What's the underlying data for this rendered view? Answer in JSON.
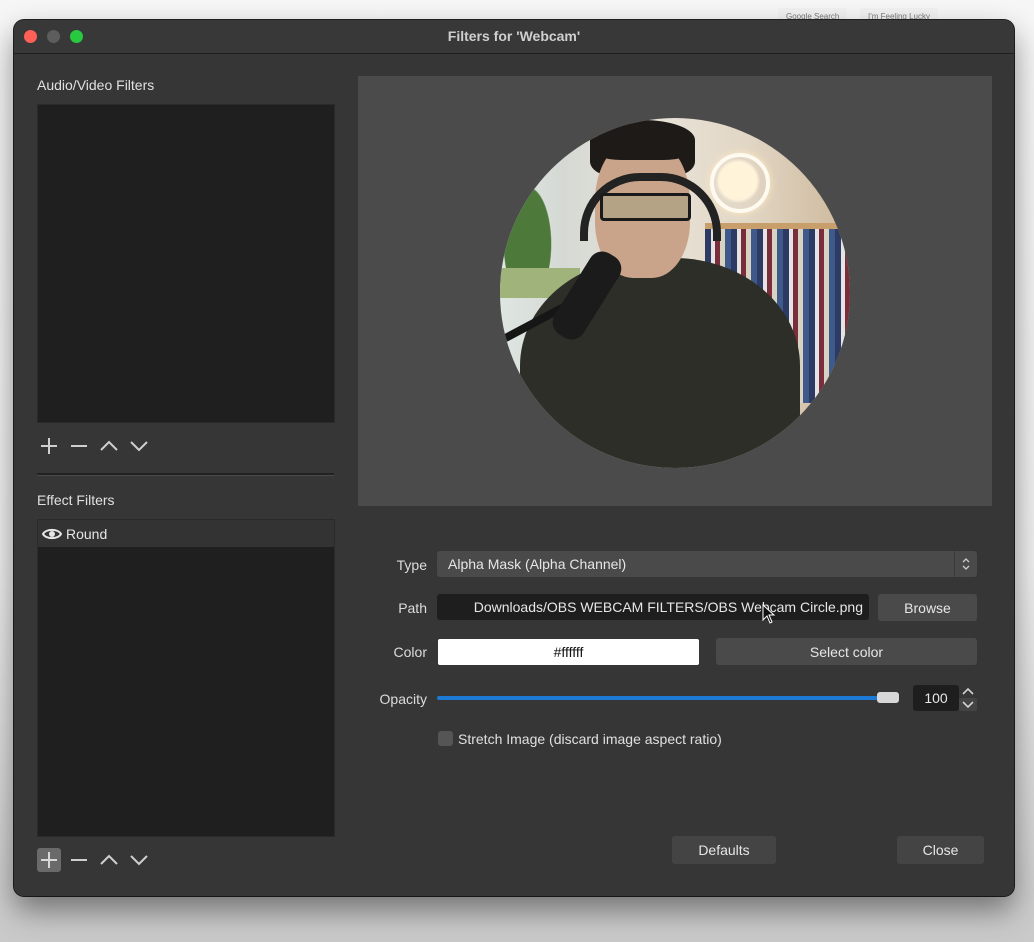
{
  "background": {
    "buttons": [
      "Google Search",
      "I'm Feeling Lucky"
    ]
  },
  "window": {
    "title": "Filters for 'Webcam'"
  },
  "audio_video_filters": {
    "label": "Audio/Video Filters",
    "items": [],
    "toolbar": [
      "add",
      "remove",
      "move-up",
      "move-down"
    ]
  },
  "effect_filters": {
    "label": "Effect Filters",
    "items": [
      {
        "name": "Round",
        "visible": true,
        "selected": true
      }
    ],
    "toolbar": [
      "add",
      "remove",
      "move-up",
      "move-down"
    ]
  },
  "properties": {
    "type": {
      "label": "Type",
      "value": "Alpha Mask (Alpha Channel)"
    },
    "path": {
      "label": "Path",
      "value": "Downloads/OBS WEBCAM FILTERS/OBS Webcam Circle.png",
      "browse_label": "Browse"
    },
    "color": {
      "label": "Color",
      "value": "#ffffff",
      "select_label": "Select color"
    },
    "opacity": {
      "label": "Opacity",
      "value": "100",
      "percent": 100
    },
    "stretch": {
      "label": "Stretch Image (discard image aspect ratio)",
      "checked": false
    }
  },
  "footer": {
    "defaults_label": "Defaults",
    "close_label": "Close"
  },
  "colors": {
    "accent": "#1c7ad6",
    "close": "#fe5f57",
    "maximize": "#28c840"
  }
}
